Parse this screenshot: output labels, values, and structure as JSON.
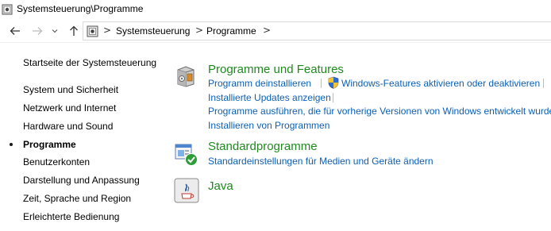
{
  "window": {
    "title": "Systemsteuerung\\Programme"
  },
  "nav": {
    "back_icon": "arrow-left-icon",
    "forward_icon": "arrow-right-icon",
    "recent_icon": "chevron-down-icon",
    "up_icon": "arrow-up-icon"
  },
  "breadcrumb": {
    "items": [
      "Systemsteuerung",
      "Programme"
    ],
    "separator": ">"
  },
  "sidebar": {
    "home_label": "Startseite der Systemsteuerung",
    "items": [
      {
        "label": "System und Sicherheit",
        "active": false
      },
      {
        "label": "Netzwerk und Internet",
        "active": false
      },
      {
        "label": "Hardware und Sound",
        "active": false
      },
      {
        "label": "Programme",
        "active": true
      },
      {
        "label": "Benutzerkonten",
        "active": false
      },
      {
        "label": "Darstellung und Anpassung",
        "active": false
      },
      {
        "label": "Zeit, Sprache und Region",
        "active": false
      },
      {
        "label": "Erleichterte Bedienung",
        "active": false
      }
    ]
  },
  "main": {
    "programs_features": {
      "title": "Programme und Features",
      "icon": "programs-box-icon",
      "links": [
        "Programm deinstallieren",
        "Windows-Features aktivieren oder deaktivieren",
        "Installierte Updates anzeigen",
        "Programme ausführen, die für vorherige Versionen von Windows entwickelt wurden",
        "Installieren von Programmen"
      ],
      "shield_icon": "uac-shield-icon"
    },
    "default_programs": {
      "title": "Standardprogramme",
      "icon": "default-programs-icon",
      "links": [
        "Standardeinstellungen für Medien und Geräte ändern"
      ]
    },
    "java": {
      "title": "Java",
      "icon": "java-icon"
    }
  },
  "colors": {
    "category_title": "#1e8a1e",
    "link": "#0c5fb5"
  }
}
